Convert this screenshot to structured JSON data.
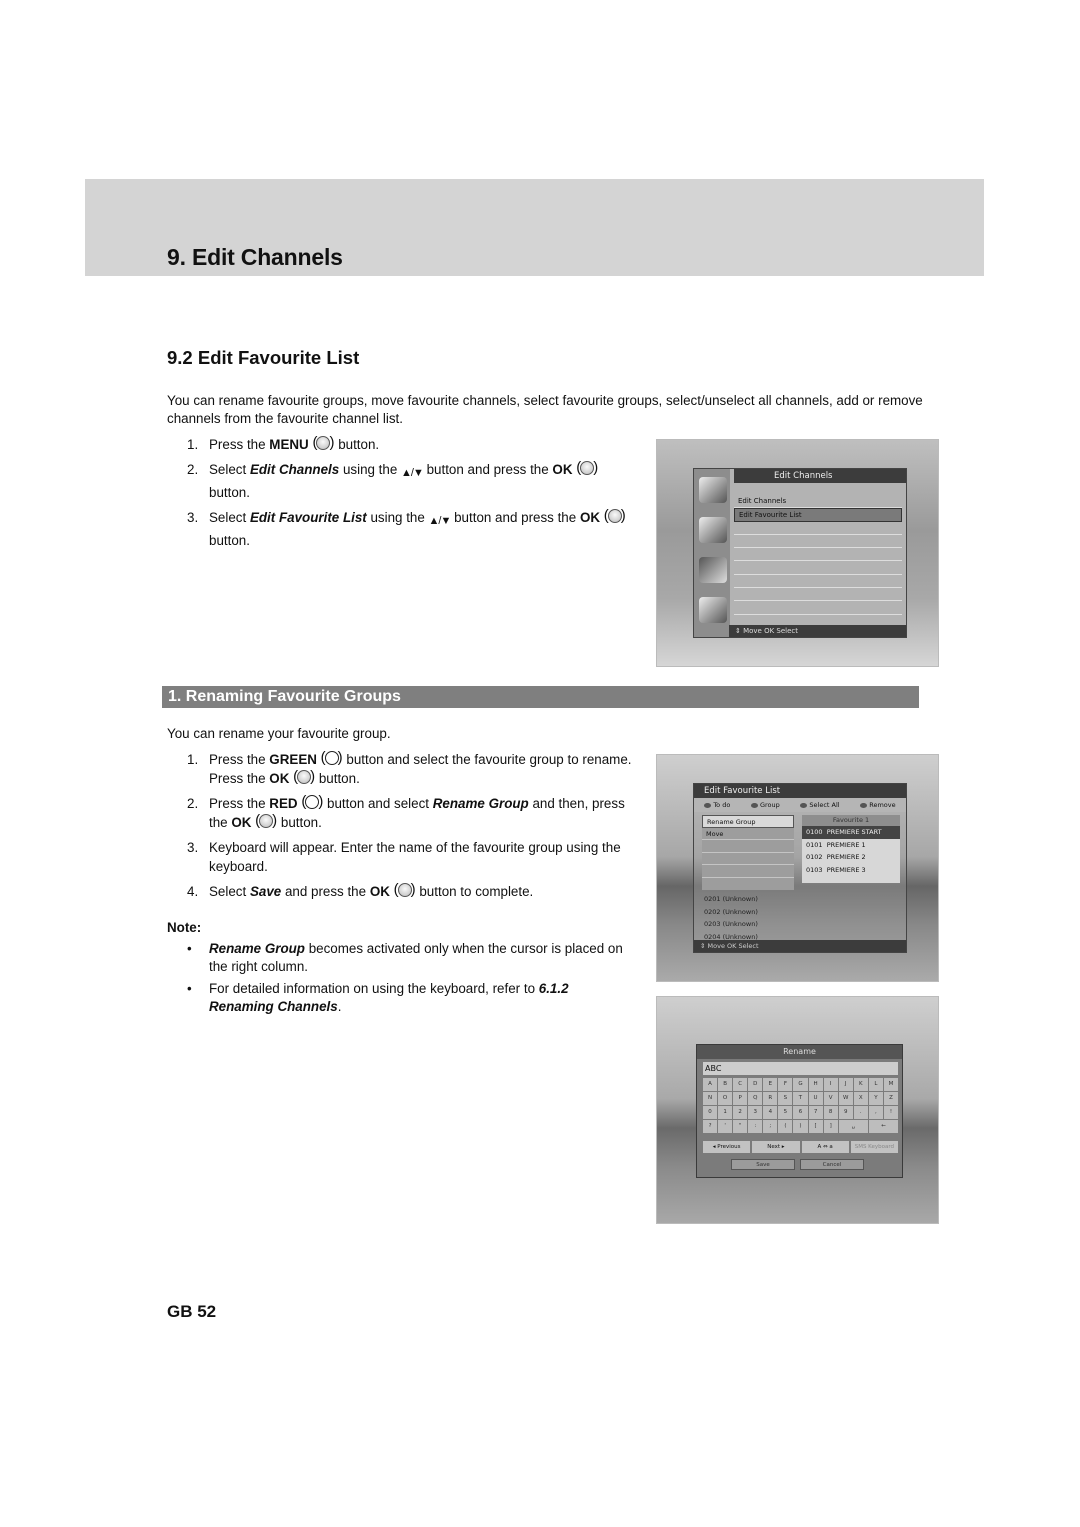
{
  "chapter": {
    "title": "9. Edit Channels"
  },
  "section": {
    "title": "9.2 Edit Favourite List",
    "intro": "You can rename favourite groups, move favourite channels, select favourite groups, select/unselect all channels, add or remove channels from the favourite channel list.",
    "steps": [
      {
        "num": "1.",
        "t1": "Press the ",
        "b1": "MENU",
        "t2": " button."
      },
      {
        "num": "2.",
        "t1": "Select ",
        "bi1": "Edit Channels",
        "t2": " using the ",
        "arrows": "▲/▼",
        "t3": " button and press the ",
        "b1": "OK",
        "t4": " button."
      },
      {
        "num": "3.",
        "t1": "Select ",
        "bi1": "Edit Favourite List",
        "t2": " using the ",
        "arrows": "▲/▼",
        "t3": " button and press the ",
        "b1": "OK",
        "t4": " button."
      }
    ]
  },
  "subsection": {
    "title": "1. Renaming Favourite Groups",
    "intro": "You can rename your favourite group.",
    "steps": [
      {
        "num": "1.",
        "t1": "Press the ",
        "b1": "GREEN",
        "t2": " button and select the favourite group to rename. Press the ",
        "b2": "OK",
        "t3": " button."
      },
      {
        "num": "2.",
        "t1": "Press the ",
        "b1": "RED",
        "t2": " button and select ",
        "bi1": "Rename Group",
        "t3": " and then, press the ",
        "b2": "OK",
        "t4": " button."
      },
      {
        "num": "3.",
        "t1": "Keyboard will appear. Enter the name of the favourite group using the keyboard."
      },
      {
        "num": "4.",
        "t1": "Select ",
        "bi1": "Save",
        "t2": " and press the ",
        "b1": "OK",
        "t3": " button to complete."
      }
    ],
    "note_label": "Note:",
    "notes": [
      {
        "bullet": "•",
        "bi1": "Rename Group",
        "t1": " becomes activated only when the cursor is placed on the right column."
      },
      {
        "bullet": "•",
        "t1": "For detailed information on using the keyboard, refer to ",
        "bi1": "6.1.2 Renaming Channels",
        "t2": "."
      }
    ]
  },
  "screens": {
    "edit_channels": {
      "title": "Edit Channels",
      "items": [
        "Edit Channels",
        "Edit Favourite List",
        "",
        "",
        "",
        "",
        "",
        "",
        ""
      ],
      "selected_index": 1,
      "footer": "⇕ Move   OK Select"
    },
    "edit_favourite_list": {
      "title": "Edit Favourite List",
      "color_keys": [
        "To do",
        "Group",
        "Select All",
        "Remove"
      ],
      "left_items": [
        "Rename Group",
        "Move",
        "",
        "",
        "",
        ""
      ],
      "right_header": "Favourite 1",
      "channels": [
        {
          "num": "0100",
          "name": "PREMIERE START"
        },
        {
          "num": "0101",
          "name": "PREMIERE 1"
        },
        {
          "num": "0102",
          "name": "PREMIERE 2"
        },
        {
          "num": "0103",
          "name": "PREMIERE 3"
        }
      ],
      "unknown_list": [
        "0201  (Unknown)",
        "0202  (Unknown)",
        "0203  (Unknown)",
        "0204  (Unknown)"
      ],
      "footer": "⇕ Move   OK Select"
    },
    "rename": {
      "title": "Rename",
      "input_value": "ABC",
      "keys": [
        "A",
        "B",
        "C",
        "D",
        "E",
        "F",
        "G",
        "H",
        "I",
        "J",
        "K",
        "L",
        "M",
        "N",
        "O",
        "P",
        "Q",
        "R",
        "S",
        "T",
        "U",
        "V",
        "W",
        "X",
        "Y",
        "Z",
        "0",
        "1",
        "2",
        "3",
        "4",
        "5",
        "6",
        "7",
        "8",
        "9",
        ".",
        ",",
        "!",
        "?",
        "'",
        "\"",
        ":",
        ";",
        "(",
        ")",
        "[",
        "]"
      ],
      "space_key": "␣",
      "backspace_key": "←",
      "options": [
        "◂ Previous",
        "Next ▸",
        "A ⇔ a",
        "SMS Keyboard"
      ],
      "actions": [
        "Save",
        "Cancel"
      ]
    }
  },
  "page_number": "GB 52"
}
